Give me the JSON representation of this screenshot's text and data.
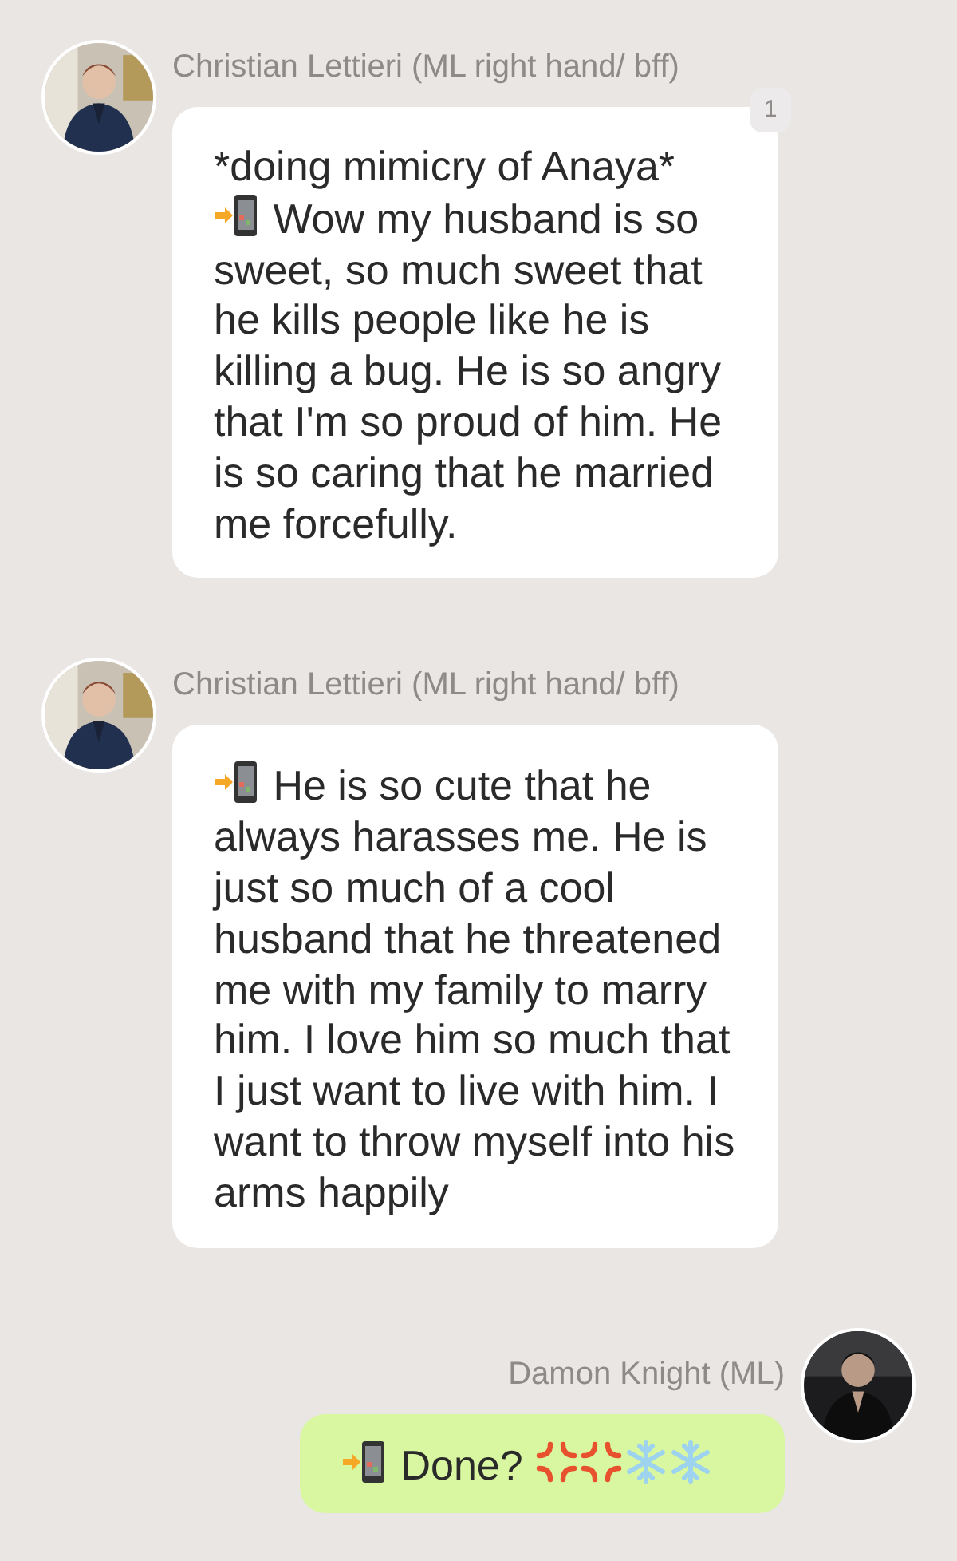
{
  "messages": [
    {
      "outgoing": false,
      "sender": "Christian Lettieri (ML right hand/ bff)",
      "avatar": {
        "kind": "picture"
      },
      "unread": "1",
      "segments": [
        {
          "kind": "text",
          "text": "*doing mimicry of Anaya*"
        },
        {
          "kind": "break"
        },
        {
          "kind": "phone"
        },
        {
          "kind": "text",
          "text": " Wow my husband is so sweet, so much sweet that he kills people like he is killing a bug. He is so angry that I'm so proud of him. He is so caring that he married me forcefully."
        }
      ]
    },
    {
      "outgoing": false,
      "sender": "Christian Lettieri (ML right hand/ bff)",
      "avatar": {
        "kind": "picture"
      },
      "segments": [
        {
          "kind": "phone"
        },
        {
          "kind": "text",
          "text": " He is so cute that he always harasses me. He is just so much of a cool husband that he threatened me with my family to marry him. I love him so much that I just want to live with him. I want to throw myself into his arms happily"
        }
      ]
    },
    {
      "outgoing": true,
      "sender": "Damon Knight (ML)",
      "avatar": {
        "kind": "picture"
      },
      "segments": [
        {
          "kind": "phone"
        },
        {
          "kind": "text",
          "text": " Done? "
        },
        {
          "kind": "anger"
        },
        {
          "kind": "anger"
        },
        {
          "kind": "snowflake"
        },
        {
          "kind": "snowflake"
        }
      ]
    }
  ]
}
